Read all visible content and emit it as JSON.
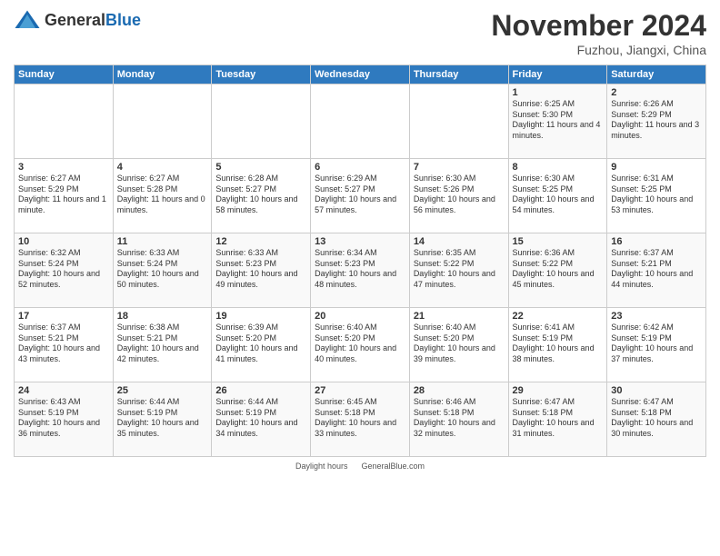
{
  "header": {
    "logo_general": "General",
    "logo_blue": "Blue",
    "month_title": "November 2024",
    "location": "Fuzhou, Jiangxi, China"
  },
  "weekdays": [
    "Sunday",
    "Monday",
    "Tuesday",
    "Wednesday",
    "Thursday",
    "Friday",
    "Saturday"
  ],
  "weeks": [
    [
      {
        "day": "",
        "info": ""
      },
      {
        "day": "",
        "info": ""
      },
      {
        "day": "",
        "info": ""
      },
      {
        "day": "",
        "info": ""
      },
      {
        "day": "",
        "info": ""
      },
      {
        "day": "1",
        "info": "Sunrise: 6:25 AM\nSunset: 5:30 PM\nDaylight: 11 hours and 4 minutes."
      },
      {
        "day": "2",
        "info": "Sunrise: 6:26 AM\nSunset: 5:29 PM\nDaylight: 11 hours and 3 minutes."
      }
    ],
    [
      {
        "day": "3",
        "info": "Sunrise: 6:27 AM\nSunset: 5:29 PM\nDaylight: 11 hours and 1 minute."
      },
      {
        "day": "4",
        "info": "Sunrise: 6:27 AM\nSunset: 5:28 PM\nDaylight: 11 hours and 0 minutes."
      },
      {
        "day": "5",
        "info": "Sunrise: 6:28 AM\nSunset: 5:27 PM\nDaylight: 10 hours and 58 minutes."
      },
      {
        "day": "6",
        "info": "Sunrise: 6:29 AM\nSunset: 5:27 PM\nDaylight: 10 hours and 57 minutes."
      },
      {
        "day": "7",
        "info": "Sunrise: 6:30 AM\nSunset: 5:26 PM\nDaylight: 10 hours and 56 minutes."
      },
      {
        "day": "8",
        "info": "Sunrise: 6:30 AM\nSunset: 5:25 PM\nDaylight: 10 hours and 54 minutes."
      },
      {
        "day": "9",
        "info": "Sunrise: 6:31 AM\nSunset: 5:25 PM\nDaylight: 10 hours and 53 minutes."
      }
    ],
    [
      {
        "day": "10",
        "info": "Sunrise: 6:32 AM\nSunset: 5:24 PM\nDaylight: 10 hours and 52 minutes."
      },
      {
        "day": "11",
        "info": "Sunrise: 6:33 AM\nSunset: 5:24 PM\nDaylight: 10 hours and 50 minutes."
      },
      {
        "day": "12",
        "info": "Sunrise: 6:33 AM\nSunset: 5:23 PM\nDaylight: 10 hours and 49 minutes."
      },
      {
        "day": "13",
        "info": "Sunrise: 6:34 AM\nSunset: 5:23 PM\nDaylight: 10 hours and 48 minutes."
      },
      {
        "day": "14",
        "info": "Sunrise: 6:35 AM\nSunset: 5:22 PM\nDaylight: 10 hours and 47 minutes."
      },
      {
        "day": "15",
        "info": "Sunrise: 6:36 AM\nSunset: 5:22 PM\nDaylight: 10 hours and 45 minutes."
      },
      {
        "day": "16",
        "info": "Sunrise: 6:37 AM\nSunset: 5:21 PM\nDaylight: 10 hours and 44 minutes."
      }
    ],
    [
      {
        "day": "17",
        "info": "Sunrise: 6:37 AM\nSunset: 5:21 PM\nDaylight: 10 hours and 43 minutes."
      },
      {
        "day": "18",
        "info": "Sunrise: 6:38 AM\nSunset: 5:21 PM\nDaylight: 10 hours and 42 minutes."
      },
      {
        "day": "19",
        "info": "Sunrise: 6:39 AM\nSunset: 5:20 PM\nDaylight: 10 hours and 41 minutes."
      },
      {
        "day": "20",
        "info": "Sunrise: 6:40 AM\nSunset: 5:20 PM\nDaylight: 10 hours and 40 minutes."
      },
      {
        "day": "21",
        "info": "Sunrise: 6:40 AM\nSunset: 5:20 PM\nDaylight: 10 hours and 39 minutes."
      },
      {
        "day": "22",
        "info": "Sunrise: 6:41 AM\nSunset: 5:19 PM\nDaylight: 10 hours and 38 minutes."
      },
      {
        "day": "23",
        "info": "Sunrise: 6:42 AM\nSunset: 5:19 PM\nDaylight: 10 hours and 37 minutes."
      }
    ],
    [
      {
        "day": "24",
        "info": "Sunrise: 6:43 AM\nSunset: 5:19 PM\nDaylight: 10 hours and 36 minutes."
      },
      {
        "day": "25",
        "info": "Sunrise: 6:44 AM\nSunset: 5:19 PM\nDaylight: 10 hours and 35 minutes."
      },
      {
        "day": "26",
        "info": "Sunrise: 6:44 AM\nSunset: 5:19 PM\nDaylight: 10 hours and 34 minutes."
      },
      {
        "day": "27",
        "info": "Sunrise: 6:45 AM\nSunset: 5:18 PM\nDaylight: 10 hours and 33 minutes."
      },
      {
        "day": "28",
        "info": "Sunrise: 6:46 AM\nSunset: 5:18 PM\nDaylight: 10 hours and 32 minutes."
      },
      {
        "day": "29",
        "info": "Sunrise: 6:47 AM\nSunset: 5:18 PM\nDaylight: 10 hours and 31 minutes."
      },
      {
        "day": "30",
        "info": "Sunrise: 6:47 AM\nSunset: 5:18 PM\nDaylight: 10 hours and 30 minutes."
      }
    ]
  ],
  "footer": {
    "daylight_label": "Daylight hours",
    "source": "GeneralBlue.com"
  }
}
